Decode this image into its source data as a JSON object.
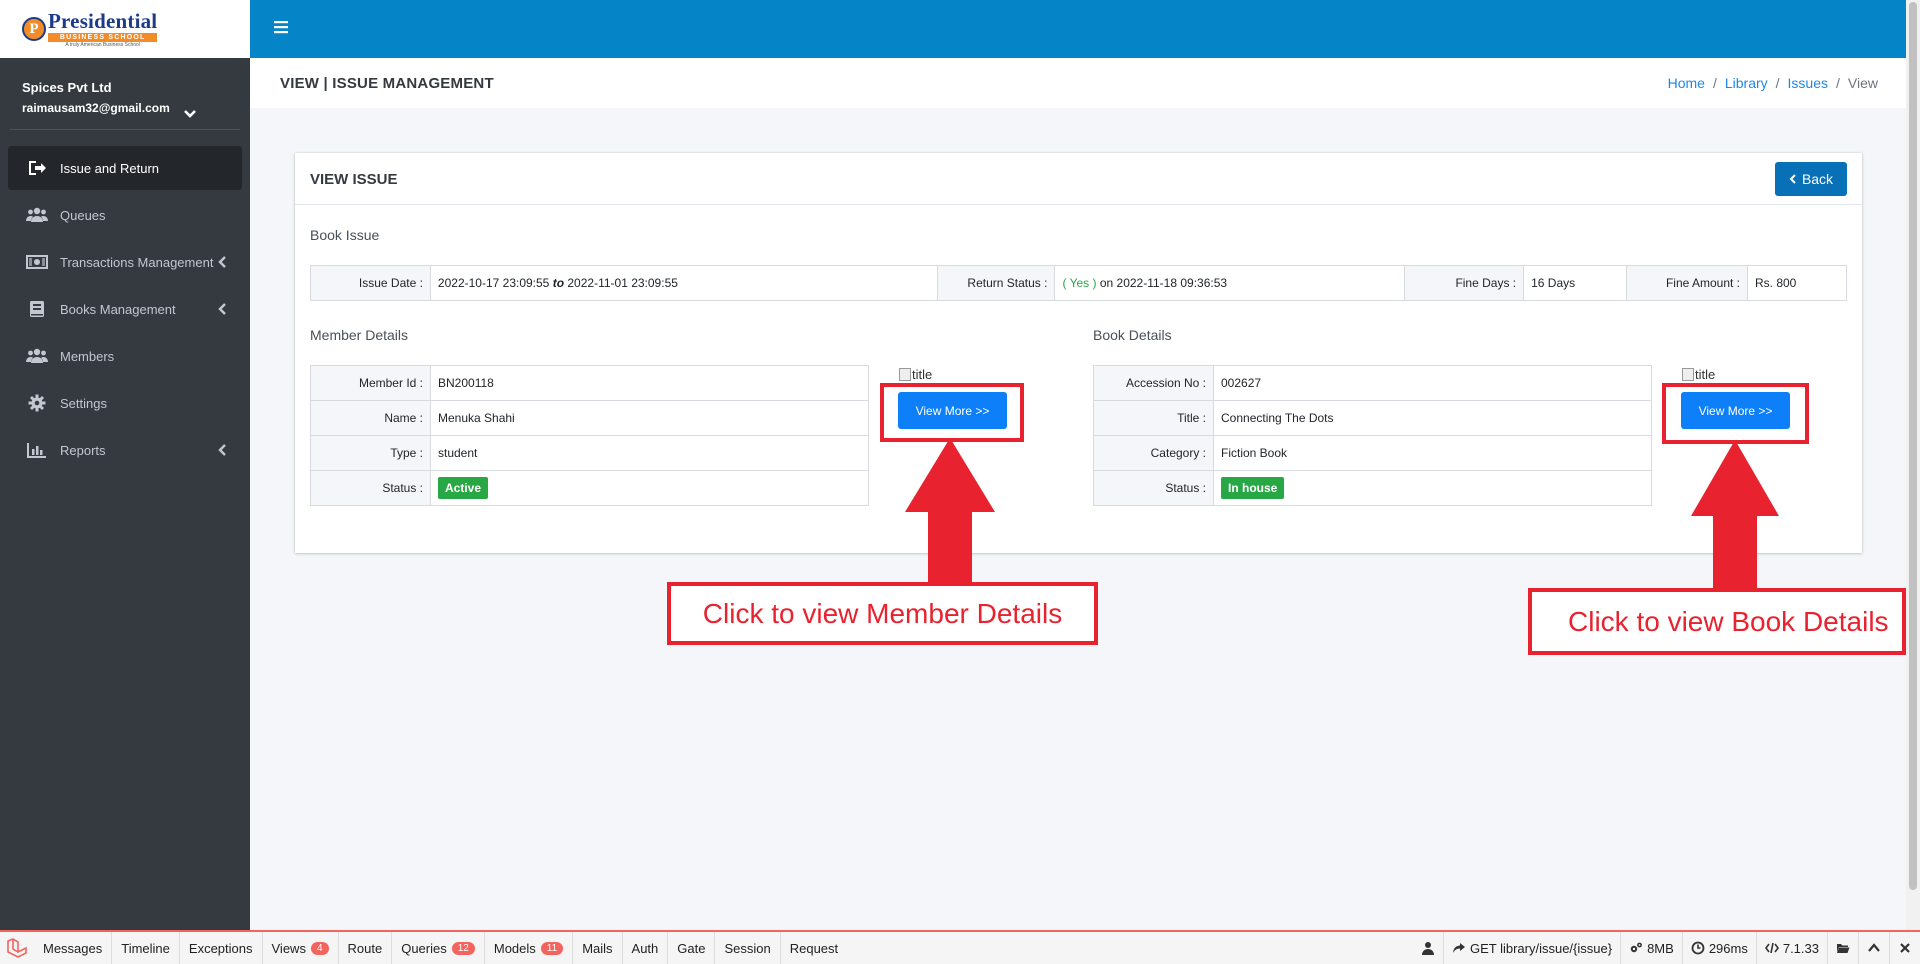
{
  "brand": {
    "logo_letter": "P",
    "logo_name": "Presidential",
    "logo_sub": "BUSINESS SCHOOL",
    "logo_tagline": "A truly American Business School"
  },
  "user": {
    "company": "Spices Pvt Ltd",
    "email": "raimausam32@gmail.com"
  },
  "nav": {
    "items": [
      {
        "label": "Issue and Return",
        "icon": "sign-out-icon",
        "active": true
      },
      {
        "label": "Queues",
        "icon": "users-icon"
      },
      {
        "label": "Transactions Management",
        "icon": "money-icon",
        "expandable": true
      },
      {
        "label": "Books Management",
        "icon": "book-icon",
        "expandable": true
      },
      {
        "label": "Members",
        "icon": "users-icon"
      },
      {
        "label": "Settings",
        "icon": "gear-icon"
      },
      {
        "label": "Reports",
        "icon": "bar-chart-icon",
        "expandable": true
      }
    ]
  },
  "header": {
    "title": "VIEW | ISSUE MANAGEMENT",
    "breadcrumb": [
      "Home",
      "Library",
      "Issues",
      "View"
    ]
  },
  "card": {
    "title": "VIEW ISSUE",
    "back_label": "Back",
    "book_issue_label": "Book Issue",
    "issue": {
      "issue_date_label": "Issue Date :",
      "issue_date_from": "2022-10-17 23:09:55",
      "issue_date_to_word": "to",
      "issue_date_to": "2022-11-01 23:09:55",
      "return_status_label": "Return Status :",
      "return_status_yes": "( Yes )",
      "return_status_on": "on 2022-11-18 09:36:53",
      "fine_days_label": "Fine Days :",
      "fine_days": "16 Days",
      "fine_amount_label": "Fine Amount :",
      "fine_amount": "Rs. 800"
    },
    "member": {
      "section_label": "Member Details",
      "rows": [
        {
          "label": "Member Id :",
          "value": "BN200118"
        },
        {
          "label": "Name :",
          "value": "Menuka Shahi"
        },
        {
          "label": "Type :",
          "value": "student"
        },
        {
          "label": "Status :",
          "value": "Active"
        }
      ],
      "image_alt": "title",
      "view_more": "View More >>"
    },
    "book": {
      "section_label": "Book Details",
      "rows": [
        {
          "label": "Accession No :",
          "value": "002627"
        },
        {
          "label": "Title :",
          "value": "Connecting The Dots"
        },
        {
          "label": "Category :",
          "value": "Fiction Book"
        },
        {
          "label": "Status :",
          "value": "In house"
        }
      ],
      "image_alt": "title",
      "view_more": "View More >>"
    }
  },
  "annotations": {
    "member": "Click to view Member Details",
    "book": "Click to view Book Details",
    "color": "#e8232f"
  },
  "debugbar": {
    "tabs": [
      {
        "label": "Messages"
      },
      {
        "label": "Timeline"
      },
      {
        "label": "Exceptions"
      },
      {
        "label": "Views",
        "badge": "4"
      },
      {
        "label": "Route"
      },
      {
        "label": "Queries",
        "badge": "12"
      },
      {
        "label": "Models",
        "badge": "11"
      },
      {
        "label": "Mails"
      },
      {
        "label": "Auth"
      },
      {
        "label": "Gate"
      },
      {
        "label": "Session"
      },
      {
        "label": "Request"
      }
    ],
    "request": "GET library/issue/{issue}",
    "memory": "8MB",
    "time": "296ms",
    "php_version": "7.1.33"
  },
  "colors": {
    "sidebar": "#343a40",
    "topbar": "#0584c7",
    "primary": "#0d7ff9",
    "success": "#28a745",
    "link": "#1e88e5"
  }
}
